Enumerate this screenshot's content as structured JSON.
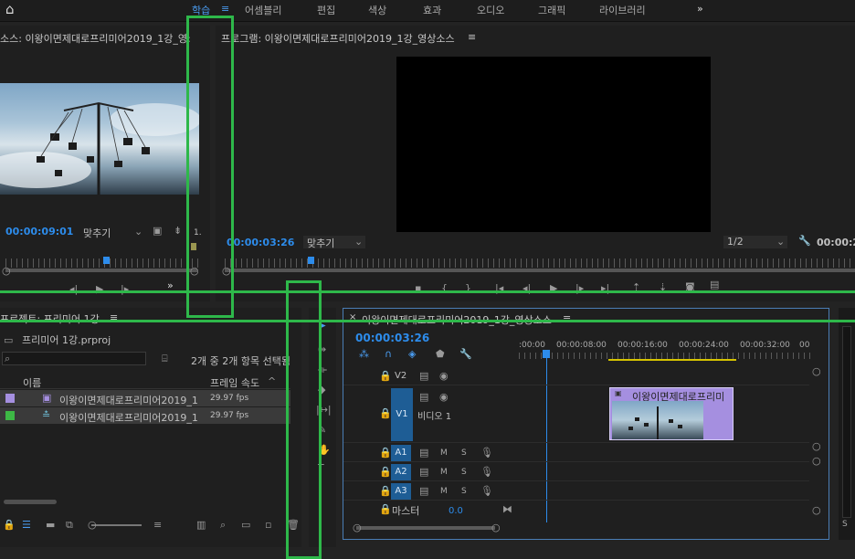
{
  "workspace_tabs": [
    "학습",
    "어셈블리",
    "편집",
    "색상",
    "효과",
    "오디오",
    "그래픽",
    "라이브러리"
  ],
  "active_tab_menu": "≡",
  "more": "»",
  "source": {
    "title": "소스: 이왕이면제대로프리미어2019_1강_영:",
    "timecode": "00:00:09:01",
    "fit": "맞추기",
    "scale": "1."
  },
  "program": {
    "title": "프로그램: 이왕이면제대로프리미어2019_1강_영상소스",
    "menu": "≡",
    "timecode": "00:00:03:26",
    "fit": "맞추기",
    "resolution": "1/2",
    "end_tc": "00:00:2"
  },
  "project": {
    "title": "프로젝트: 프리미어 1강",
    "menu": "≡",
    "file": "프리미어 1강.prproj",
    "count": "2개 중 2개 항목 선택됨",
    "col_name": "이름",
    "col_rate": "프레임 속도",
    "items": [
      {
        "name": "이왕이면제대로프리미어2019_1",
        "rate": "29.97 fps",
        "color": "#a58fe0"
      },
      {
        "name": "이왕이면제대로프리미어2019_1",
        "rate": "29.97 fps",
        "color": "#3db845"
      }
    ]
  },
  "timeline": {
    "close": "×",
    "title": "이왕이면제대로프리미어2019_1강_영상소스",
    "menu": "≡",
    "timecode": "00:00:03:26",
    "ruler": [
      ":00:00",
      "00:00:08:00",
      "00:00:16:00",
      "00:00:24:00",
      "00:00:32:00",
      "00"
    ],
    "tracks": {
      "v2": "V2",
      "v1": "V1",
      "v1_name": "비디오 1",
      "a1": "A1",
      "a2": "A2",
      "a3": "A3",
      "m": "M",
      "s": "S",
      "master": "마스터",
      "master_val": "0.0"
    },
    "clip_label": "이왕이면제대로프리미",
    "accent": "#2d8ceb",
    "clip_color": "#a58fe0"
  },
  "highlight_color": "#2eb84a"
}
